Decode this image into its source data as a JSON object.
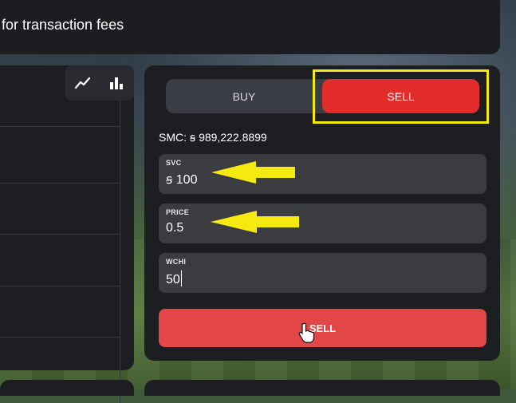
{
  "header": {
    "notice": "for transaction fees"
  },
  "chart_tools": {
    "line_icon": "line-chart-icon",
    "bar_icon": "bar-chart-icon"
  },
  "trade": {
    "tabs": {
      "buy": "BUY",
      "sell": "SELL",
      "active": "sell"
    },
    "balance": "SMC: ꞩ 989,222.8899",
    "fields": [
      {
        "label": "SVC",
        "value": "ꞩ 100"
      },
      {
        "label": "PRICE",
        "value": "0.5"
      },
      {
        "label": "WCHI",
        "value": "50"
      }
    ],
    "submit_label": "SELL"
  },
  "colors": {
    "sell_active": "#e22d2a",
    "sell_button": "#e24646",
    "annotation": "#f5ea10",
    "panel": "#1d1e22"
  }
}
